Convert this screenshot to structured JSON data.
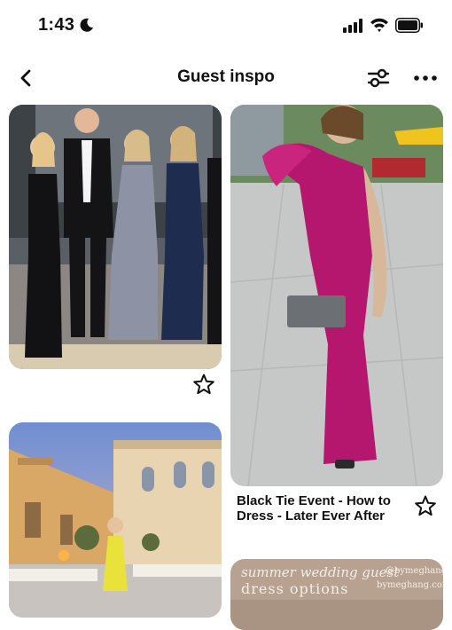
{
  "status_bar": {
    "time": "1:43",
    "icons": [
      "moon-icon",
      "cellular-signal-icon",
      "wifi-icon",
      "battery-icon"
    ]
  },
  "header": {
    "title": "Guest inspo",
    "back_icon": "chevron-left-icon",
    "filter_icon": "sliders-icon",
    "more_icon": "ellipsis-icon"
  },
  "pins": [
    {
      "image": "group-photo-formal-gowns",
      "title": "",
      "save_icon": "star-outline-icon"
    },
    {
      "image": "magenta-one-shoulder-gown",
      "title": "Black Tie Event - How to Dress - Later Ever After",
      "save_icon": "star-outline-icon"
    },
    {
      "image": "evening-courtyard-yellow-dress",
      "title": ""
    },
    {
      "image": "summer-wedding-guest-graphic",
      "overlay_line1": "summer wedding guest",
      "overlay_line2": "dress options",
      "overlay_handle": "@bymeghang",
      "overlay_site": "bymeghang.com"
    }
  ],
  "colors": {
    "background": "#ffffff",
    "text": "#111111",
    "magenta_dress": "#b5176e"
  }
}
